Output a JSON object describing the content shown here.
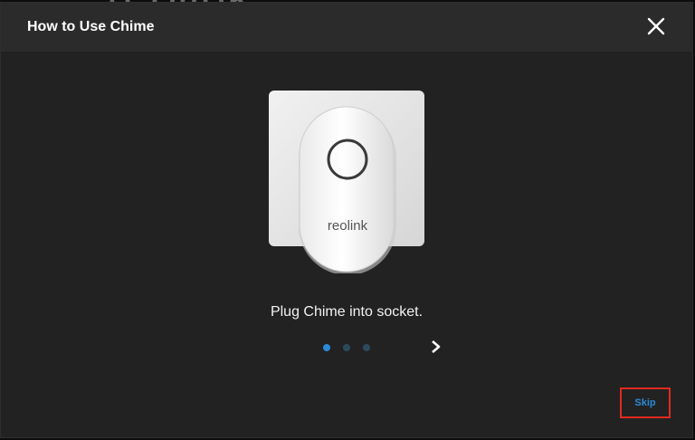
{
  "background": {
    "logo_text": "reolink"
  },
  "dialog": {
    "title": "How to Use Chime",
    "close_icon": "close-icon"
  },
  "illustration": {
    "brand_text": "reolink"
  },
  "step": {
    "caption": "Plug Chime into socket.",
    "total_steps": 3,
    "current_step": 1
  },
  "actions": {
    "skip_label": "Skip",
    "next_icon": "chevron-right-icon"
  },
  "colors": {
    "accent": "#2b8ad8",
    "dot_inactive": "#2d4a5c",
    "highlight_border": "#e02a1e",
    "dialog_bg": "#222222",
    "header_bg": "#2b2b2b"
  }
}
